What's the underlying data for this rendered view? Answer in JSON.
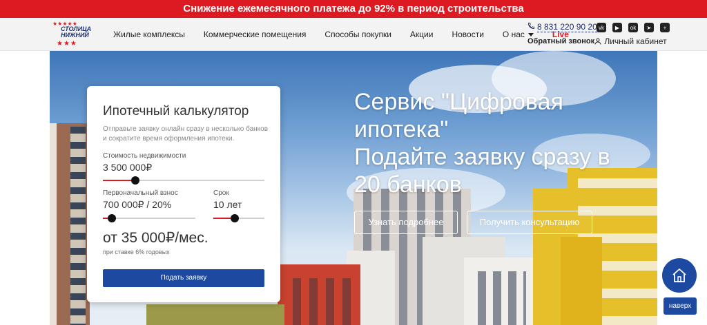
{
  "promo": {
    "text": "Снижение ежемесячного платежа до 92% в период строительства"
  },
  "logo": {
    "line1": "СТОЛИЦА",
    "line2": "НИЖНИЙ"
  },
  "nav": {
    "items": [
      {
        "label": "Жилые комплексы"
      },
      {
        "label": "Коммерческие помещения"
      },
      {
        "label": "Способы покупки"
      },
      {
        "label": "Акции"
      },
      {
        "label": "Новости"
      },
      {
        "label": "О нас"
      },
      {
        "label": "Live"
      }
    ]
  },
  "contacts": {
    "phone": "8 831 220 90 20",
    "callback": "Обратный звонок"
  },
  "socials": [
    "vk-icon",
    "youtube-icon",
    "odnoklassniki-icon",
    "telegram-icon",
    "plus-icon"
  ],
  "account": {
    "label": "Личный кабинет"
  },
  "calculator": {
    "title": "Ипотечный калькулятор",
    "subtitle": "Отправьте заявку онлайн сразу в несколько банков и сократите время оформления ипотеки.",
    "price_label": "Стоимость недвижимости",
    "price_value": "3 500 000₽",
    "price_fraction": 0.2,
    "downpayment_label": "Первоначальный взнос",
    "downpayment_value": "700 000₽ / 20%",
    "downpayment_fraction": 0.1,
    "term_label": "Срок",
    "term_value": "10 лет",
    "term_fraction": 0.42,
    "result": "от 35 000₽/мес.",
    "rate_note": "при ставке 6% годовых",
    "submit_label": "Подать заявку"
  },
  "hero": {
    "title_line1": "Сервис \"Цифровая ипотека\"",
    "title_line2": "Подайте заявку сразу в 20 банков",
    "btn_more": "Узнать подробнее",
    "btn_consult": "Получить консультацию"
  },
  "floating": {
    "up_label": "наверх"
  },
  "colors": {
    "brand_red": "#dd1a22",
    "brand_blue": "#1d4aa0"
  }
}
